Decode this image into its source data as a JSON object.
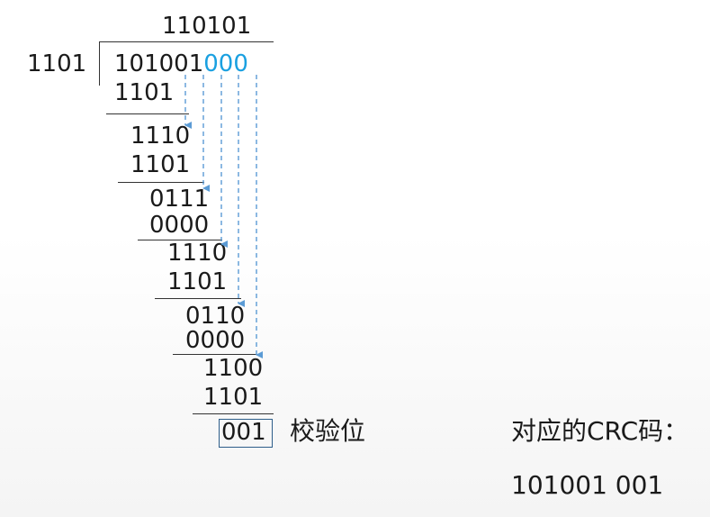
{
  "quotient": "110101",
  "divisor": "1101",
  "dividend": {
    "data_bits": "101001",
    "appended_zeros": "000"
  },
  "steps": [
    {
      "subtract": "1101",
      "result": "1110"
    },
    {
      "subtract": "1101",
      "result": "0111"
    },
    {
      "subtract": "0000",
      "result": "1110"
    },
    {
      "subtract": "1101",
      "result": "0110"
    },
    {
      "subtract": "0000",
      "result": "1100"
    },
    {
      "subtract": "1101",
      "result": "001"
    }
  ],
  "check_bits_label": "校验位",
  "crc_label": "对应的CRC码：",
  "crc_value": "101001 001",
  "colors": {
    "highlight": "#1aa0e0",
    "arrow": "#5b9bd5",
    "box": "#2e5e8a"
  }
}
